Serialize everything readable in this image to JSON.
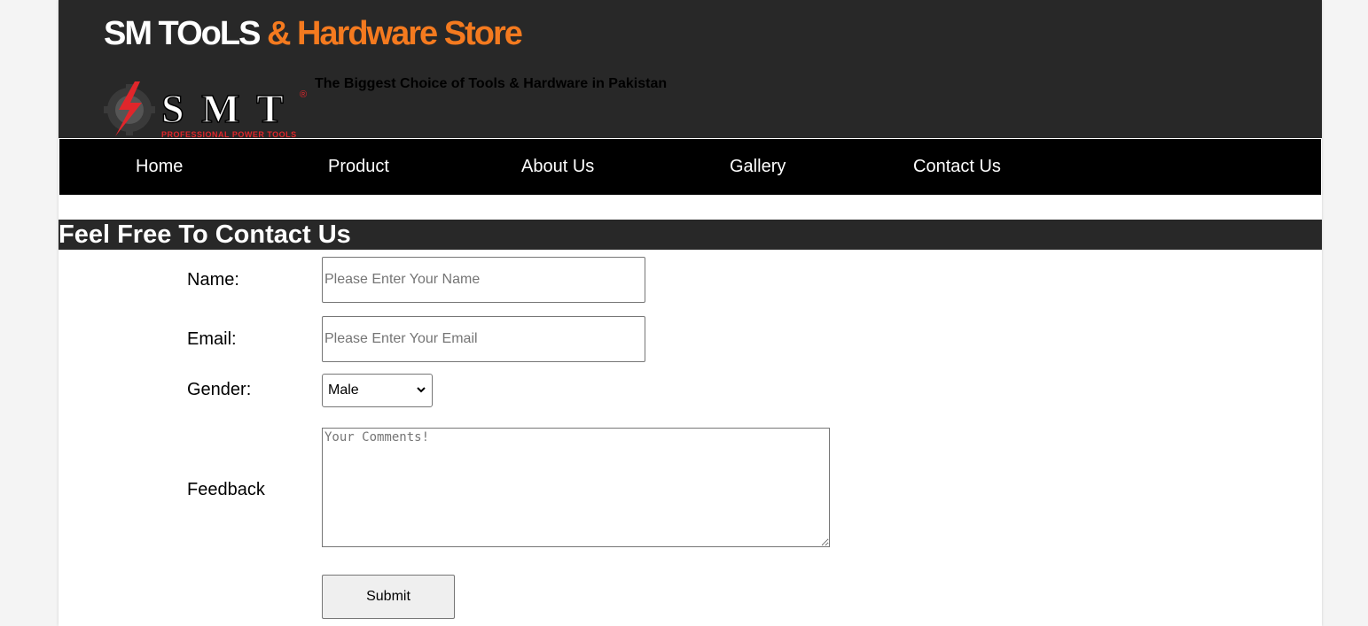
{
  "header": {
    "title_part1": "SM TOoLS",
    "title_part2": "& Hardware Store",
    "tagline": "The Biggest Choice of Tools & Hardware in Pakistan",
    "logo_text": "S M T",
    "logo_subtext": "PROFESSIONAL POWER TOOLS",
    "logo_mark": "®"
  },
  "nav": {
    "items": [
      "Home",
      "Product",
      "About Us",
      "Gallery",
      "Contact Us"
    ]
  },
  "form": {
    "heading": "Feel Free To Contact Us",
    "name_label": "Name:",
    "name_placeholder": "Please Enter Your Name",
    "email_label": "Email:",
    "email_placeholder": "Please Enter Your Email",
    "gender_label": "Gender:",
    "gender_selected": "Male",
    "feedback_label": "Feedback",
    "feedback_placeholder": "Your Comments!",
    "submit_label": "Submit"
  },
  "colors": {
    "header_bg": "#282828",
    "nav_bg": "#000000",
    "accent_orange": "#f47a1f",
    "logo_red": "#e0262b"
  }
}
